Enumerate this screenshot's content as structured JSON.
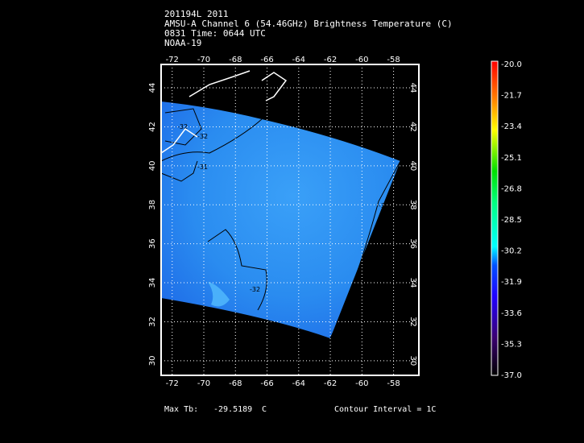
{
  "header": {
    "line1": "201194L 2011",
    "line2": "AMSU-A Channel 6 (54.46GHz) Brightness Temperature (C)",
    "line3": "0831 Time: 0644 UTC",
    "line4": "NOAA-19"
  },
  "footer": {
    "max_label": "Max Tb:",
    "max_value": "-29.5189",
    "max_unit": "C",
    "contour": "Contour Interval = 1C"
  },
  "chart_data": {
    "type": "heatmap",
    "title": "AMSU-A Channel 6 (54.46GHz) Brightness Temperature (C)",
    "x_ticks": [
      "-72",
      "-70",
      "-68",
      "-66",
      "-64",
      "-62",
      "-60",
      "-58"
    ],
    "y_ticks": [
      "30",
      "32",
      "34",
      "36",
      "38",
      "40",
      "42",
      "44"
    ],
    "xlim": [
      -72.7,
      -56.4
    ],
    "ylim": [
      29.25,
      45.2
    ],
    "grid": true,
    "colorbar": {
      "ticks": [
        "-20.0",
        "-21.7",
        "-23.4",
        "-25.1",
        "-26.8",
        "-28.5",
        "-30.2",
        "-31.9",
        "-33.6",
        "-35.3",
        "-37.0"
      ],
      "range": [
        -37.0,
        -20.0
      ],
      "placement": "right"
    },
    "contour_labels": [
      "-32",
      "-31",
      "-32",
      "-32",
      "-32"
    ],
    "field_color": "#2a8cf0"
  }
}
